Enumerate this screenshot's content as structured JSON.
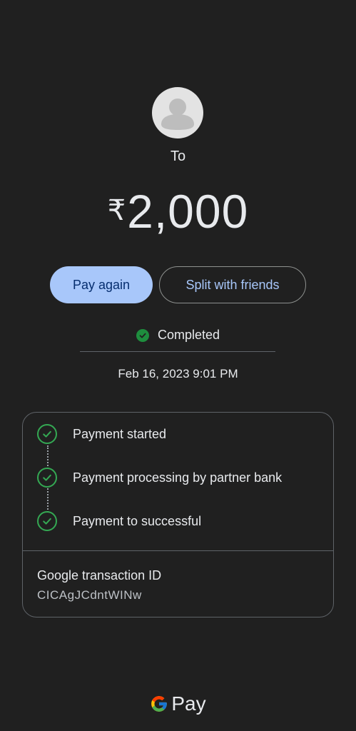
{
  "recipient": {
    "prefix": "To",
    "avatar_icon": "person-icon"
  },
  "amount": {
    "currency": "₹",
    "value": "2,000"
  },
  "actions": {
    "pay_again": "Pay again",
    "split": "Split with friends"
  },
  "status": {
    "text": "Completed",
    "icon": "check-circle-icon",
    "color": "#1e8e3e"
  },
  "datetime": "Feb 16, 2023 9:01 PM",
  "steps": [
    {
      "label": "Payment started"
    },
    {
      "label": "Payment processing by partner bank"
    },
    {
      "label": "Payment to  successful"
    }
  ],
  "transaction": {
    "title": "Google transaction ID",
    "id": "CICAgJCdntWINw"
  },
  "brand": {
    "pay_text": "Pay"
  },
  "colors": {
    "accent": "#a8c7fa",
    "success": "#34a853",
    "background": "#202020"
  }
}
